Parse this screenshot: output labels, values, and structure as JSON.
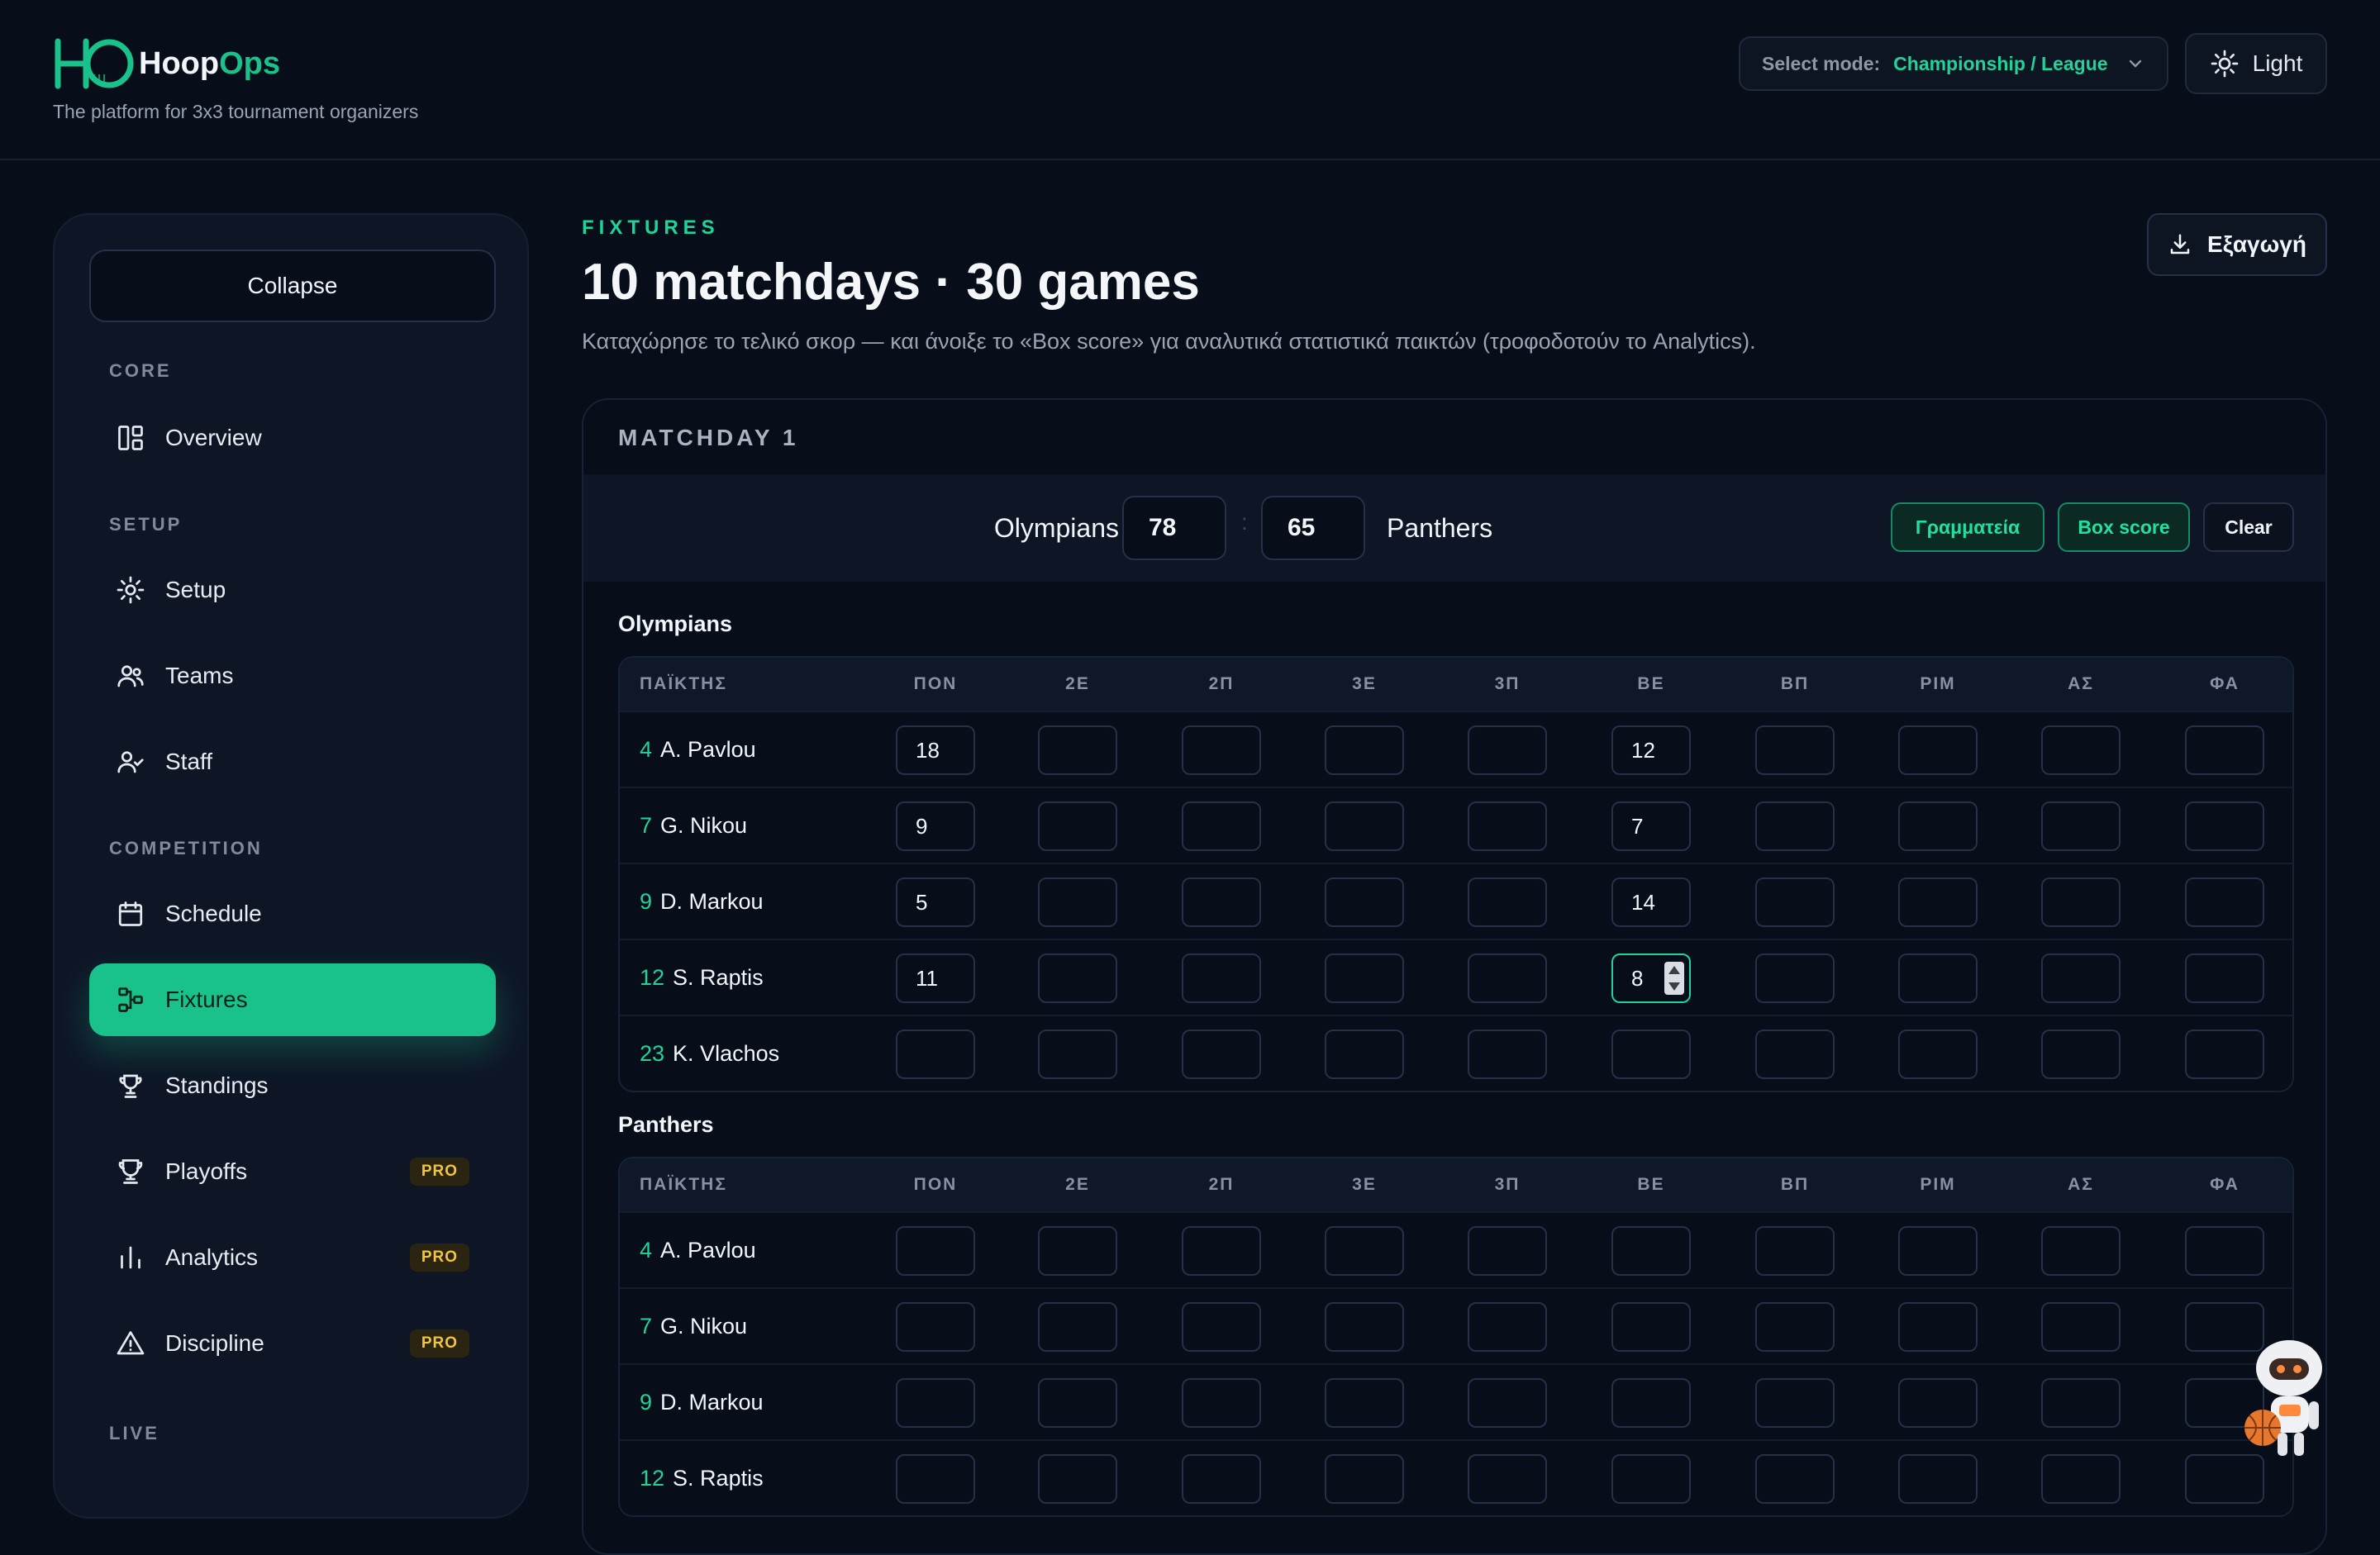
{
  "header": {
    "brand_prefix": "Hoop",
    "brand_suffix": "Ops",
    "tagline": "The platform for 3x3 tournament organizers",
    "mode_label": "Select mode:",
    "mode_value": "Championship / League",
    "theme_label": "Light"
  },
  "sidebar": {
    "collapse_label": "Collapse",
    "sections": {
      "core": "CORE",
      "setup": "SETUP",
      "competition": "COMPETITION",
      "live": "LIVE"
    },
    "items": {
      "overview": "Overview",
      "setup": "Setup",
      "teams": "Teams",
      "staff": "Staff",
      "schedule": "Schedule",
      "fixtures": "Fixtures",
      "standings": "Standings",
      "playoffs": "Playoffs",
      "analytics": "Analytics",
      "discipline": "Discipline"
    },
    "pro_badge": "PRO",
    "active_item": "fixtures"
  },
  "main": {
    "eyebrow": "FIXTURES",
    "title": "10 matchdays · 30 games",
    "subtitle": "Καταχώρησε το τελικό σκορ — και άνοιξε το «Box score» για αναλυτικά στατιστικά παικτών (τροφοδοτούν το Analytics).",
    "export_label": "Εξαγωγή"
  },
  "matchday": {
    "title": "MATCHDAY 1",
    "home_team": "Olympians",
    "home_score": "78",
    "score_separator": ":",
    "away_score": "65",
    "away_team": "Panthers",
    "buttons": {
      "secretariat": "Γραμματεία",
      "box_score": "Box score",
      "clear": "Clear"
    }
  },
  "columns": [
    "ΠΑΪΚΤΗΣ",
    "ΠΟΝ",
    "2Ε",
    "2Π",
    "3Ε",
    "3Π",
    "ΒΕ",
    "ΒΠ",
    "ΡΙΜ",
    "ΑΣ",
    "ΦΑ"
  ],
  "home_box": {
    "team": "Olympians",
    "rows": [
      {
        "num": "4",
        "name": "A. Pavlou",
        "values": [
          "18",
          "",
          "",
          "",
          "",
          "12",
          "",
          "",
          "",
          ""
        ]
      },
      {
        "num": "7",
        "name": "G. Nikou",
        "values": [
          "9",
          "",
          "",
          "",
          "",
          "7",
          "",
          "",
          "",
          ""
        ]
      },
      {
        "num": "9",
        "name": "D. Markou",
        "values": [
          "5",
          "",
          "",
          "",
          "",
          "14",
          "",
          "",
          "",
          ""
        ]
      },
      {
        "num": "12",
        "name": "S. Raptis",
        "values": [
          "11",
          "",
          "",
          "",
          "",
          "8",
          "",
          "",
          "",
          ""
        ]
      },
      {
        "num": "23",
        "name": "K. Vlachos",
        "values": [
          "",
          "",
          "",
          "",
          "",
          "",
          "",
          "",
          "",
          ""
        ]
      }
    ]
  },
  "away_box": {
    "team": "Panthers",
    "rows": [
      {
        "num": "4",
        "name": "A. Pavlou",
        "values": [
          "",
          "",
          "",
          "",
          "",
          "",
          "",
          "",
          "",
          ""
        ]
      },
      {
        "num": "7",
        "name": "G. Nikou",
        "values": [
          "",
          "",
          "",
          "",
          "",
          "",
          "",
          "",
          "",
          ""
        ]
      },
      {
        "num": "9",
        "name": "D. Markou",
        "values": [
          "",
          "",
          "",
          "",
          "",
          "",
          "",
          "",
          "",
          ""
        ]
      },
      {
        "num": "12",
        "name": "S. Raptis",
        "values": [
          "",
          "",
          "",
          "",
          "",
          "",
          "",
          "",
          "",
          ""
        ]
      }
    ]
  },
  "colors": {
    "accent": "#19c28a",
    "background": "#070d19",
    "panel": "#0e1626",
    "pro_badge": "#f2c53d"
  }
}
